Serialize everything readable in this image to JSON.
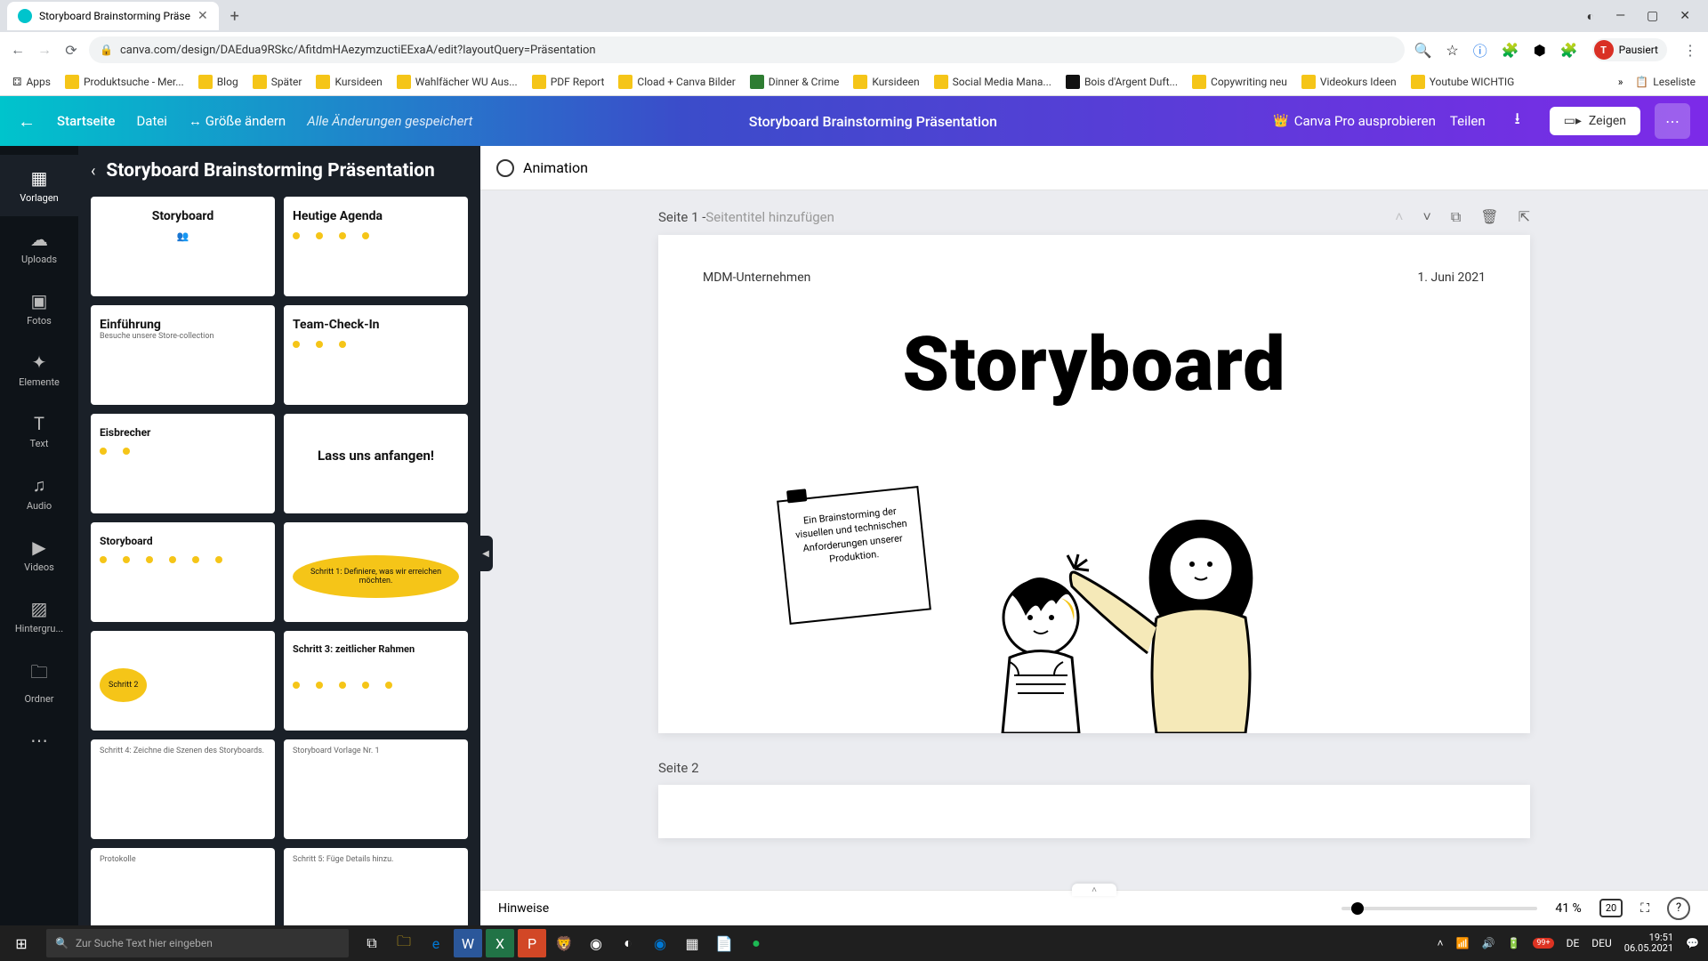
{
  "browser": {
    "tab_title": "Storyboard Brainstorming Präse",
    "url": "canva.com/design/DAEdua9RSkc/AfitdmHAezymzuctiEExaA/edit?layoutQuery=Präsentation",
    "account_status": "Pausiert",
    "account_initial": "T",
    "bookmarks": [
      "Apps",
      "Produktsuche - Mer...",
      "Blog",
      "Später",
      "Kursideen",
      "Wahlfächer WU Aus...",
      "PDF Report",
      "Cload + Canva Bilder",
      "Dinner & Crime",
      "Kursideen",
      "Social Media Mana...",
      "Bois d'Argent Duft...",
      "Copywriting neu",
      "Videokurs Ideen",
      "Youtube WICHTIG"
    ],
    "bookmarks_overflow": "Leseliste"
  },
  "canva": {
    "home": "Startseite",
    "file": "Datei",
    "resize": "Größe ändern",
    "saved": "Alle Änderungen gespeichert",
    "doc_title": "Storyboard Brainstorming Präsentation",
    "pro": "Canva Pro ausprobieren",
    "share": "Teilen",
    "present": "Zeigen"
  },
  "sidebar": {
    "items": [
      {
        "label": "Vorlagen",
        "icon": "▦"
      },
      {
        "label": "Uploads",
        "icon": "☁"
      },
      {
        "label": "Fotos",
        "icon": "▣"
      },
      {
        "label": "Elemente",
        "icon": "✦"
      },
      {
        "label": "Text",
        "icon": "T"
      },
      {
        "label": "Audio",
        "icon": "♫"
      },
      {
        "label": "Videos",
        "icon": "▶"
      },
      {
        "label": "Hintergru...",
        "icon": "▨"
      },
      {
        "label": "Ordner",
        "icon": "🗀"
      },
      {
        "label": "",
        "icon": "⋯"
      }
    ]
  },
  "templates": {
    "title": "Storyboard Brainstorming Präsentation",
    "thumbs": [
      {
        "title": "Storyboard"
      },
      {
        "title": "Heutige Agenda"
      },
      {
        "title": "Einführung"
      },
      {
        "title": "Team-Check-In"
      },
      {
        "title": "Eisbrecher"
      },
      {
        "title": "Lass uns anfangen!"
      },
      {
        "title": "Storyboard"
      },
      {
        "title": "Schritt 1: Definiere, was wir erreichen möchten."
      },
      {
        "title": "Schritt 2"
      },
      {
        "title": "Schritt 3: zeitlicher Rahmen"
      },
      {
        "title": "Schritt 4: Zeichne die Szenen des Storyboards."
      },
      {
        "title": "Storyboard Vorlage Nr. 1"
      },
      {
        "title": "Protokolle"
      },
      {
        "title": "Schritt 5: Füge Details hinzu."
      }
    ]
  },
  "animation": {
    "label": "Animation"
  },
  "page1": {
    "label": "Seite 1 - ",
    "placeholder": "Seitentitel hinzufügen",
    "company": "MDM-Unternehmen",
    "date": "1. Juni 2021",
    "heading": "Storyboard",
    "note": "Ein Brainstorming der visuellen und technischen Anforderungen unserer Produktion."
  },
  "page2": {
    "label": "Seite 2"
  },
  "footer": {
    "notes": "Hinweise",
    "zoom_pct": "41 %",
    "grid_count": "20"
  },
  "taskbar": {
    "search_placeholder": "Zur Suche Text hier eingeben",
    "lang": "DE",
    "kb": "DEU",
    "time": "19:51",
    "date": "06.05.2021",
    "tray_badge": "99+"
  }
}
